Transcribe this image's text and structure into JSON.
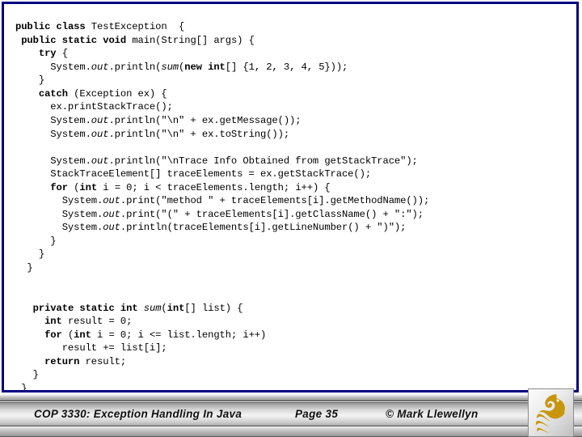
{
  "slide": {
    "border_color": "#000080",
    "background_color": "#ffffff"
  },
  "code": {
    "language": "java",
    "lines": [
      "public class TestException  {",
      " public static void main(String[] args) {",
      "    try {",
      "      System.out.println(sum(new int[] {1, 2, 3, 4, 5}));",
      "    }",
      "    catch (Exception ex) {",
      "      ex.printStackTrace();",
      "      System.out.println(\"\\n\" + ex.getMessage());",
      "      System.out.println(\"\\n\" + ex.toString());",
      "",
      "      System.out.println(\"\\nTrace Info Obtained from getStackTrace\");",
      "      StackTraceElement[] traceElements = ex.getStackTrace();",
      "      for (int i = 0; i < traceElements.length; i++) {",
      "        System.out.print(\"method \" + traceElements[i].getMethodName());",
      "        System.out.print(\"(\" + traceElements[i].getClassName() + \":\");",
      "        System.out.println(traceElements[i].getLineNumber() + \")\");",
      "      }",
      "    }",
      "  }",
      "",
      "",
      "   private static int sum(int[] list) {",
      "     int result = 0;",
      "     for (int i = 0; i <= list.length; i++)",
      "        result += list[i];",
      "     return result;",
      "   }",
      " }"
    ]
  },
  "footer": {
    "title": "COP 3330:  Exception Handling In Java",
    "page": "Page 35",
    "copyright": "© Mark Llewellyn",
    "logo_name": "ucf-pegasus-logo",
    "logo_color": "#c8960c"
  }
}
